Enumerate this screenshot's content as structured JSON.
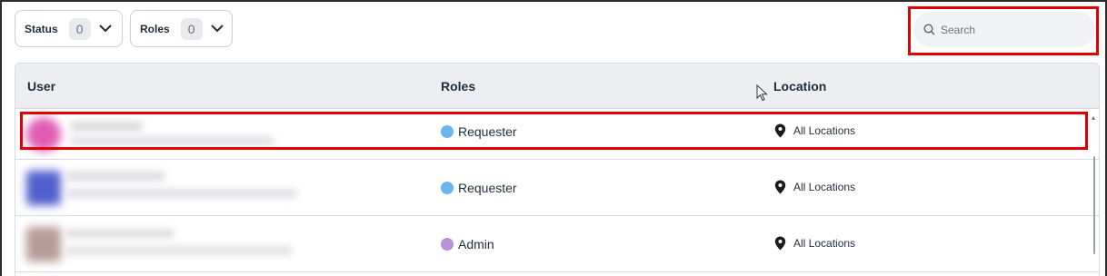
{
  "filters": {
    "status": {
      "label": "Status",
      "count": "0"
    },
    "roles": {
      "label": "Roles",
      "count": "0"
    }
  },
  "search": {
    "placeholder": "Search",
    "value": ""
  },
  "table": {
    "columns": [
      "User",
      "Roles",
      "Location"
    ],
    "rows": [
      {
        "role": "Requester",
        "role_color": "#6cb6f0",
        "location": "All Locations",
        "avatar_color": "#e05cb4"
      },
      {
        "role": "Requester",
        "role_color": "#6cb6f0",
        "location": "All Locations",
        "avatar_color": "#5160cc"
      },
      {
        "role": "Admin",
        "role_color": "#b792d8",
        "location": "All Locations",
        "avatar_color": "#b79c96"
      }
    ]
  },
  "icons": {
    "chevron": "chevron-down-icon",
    "search": "search-icon",
    "location": "location-pin-icon",
    "cursor": "mouse-pointer-icon"
  },
  "colors": {
    "highlight": "#e00000",
    "header_bg": "#edeef1",
    "text": "#1f2d3d"
  }
}
